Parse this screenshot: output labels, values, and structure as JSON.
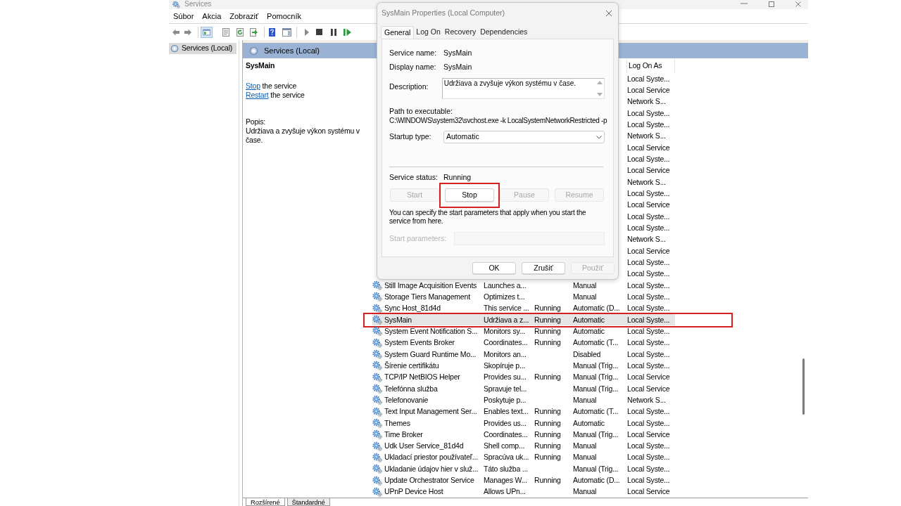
{
  "window": {
    "title": "Services"
  },
  "menu": [
    {
      "label": "Súbor"
    },
    {
      "label": "Akcia"
    },
    {
      "label": "Zobraziť"
    },
    {
      "label": "Pomocník"
    }
  ],
  "tree": {
    "items": [
      {
        "label": "Services (Local)",
        "selected": true
      }
    ]
  },
  "pane": {
    "title": "Services (Local)"
  },
  "details": {
    "title": "SysMain",
    "actions": [
      {
        "link": "Stop",
        "text": "the service"
      },
      {
        "link": "Restart",
        "text": "the service"
      }
    ],
    "description_label": "Popis:",
    "description": "Udržiava a zvyšuje výkon systému v čase."
  },
  "table": {
    "header": {
      "log_on_as": "Log On As"
    },
    "rows": [
      {
        "log_on_as": "Local Syste...",
        "selected": false,
        "annotated": false
      },
      {
        "log_on_as": "Local Service",
        "selected": false,
        "annotated": false
      },
      {
        "log_on_as": "Network S...",
        "selected": false,
        "annotated": false
      },
      {
        "log_on_as": "Local Syste...",
        "selected": false,
        "annotated": false
      },
      {
        "log_on_as": "Local Syste...",
        "selected": false,
        "annotated": false
      },
      {
        "log_on_as": "Network S...",
        "selected": false,
        "annotated": false
      },
      {
        "log_on_as": "Local Service",
        "selected": false,
        "annotated": false
      },
      {
        "log_on_as": "Local Syste...",
        "selected": false,
        "annotated": false
      },
      {
        "log_on_as": "Local Service",
        "selected": false,
        "annotated": false
      },
      {
        "log_on_as": "Network S...",
        "selected": false,
        "annotated": false
      },
      {
        "log_on_as": "Local Syste...",
        "selected": false,
        "annotated": false
      },
      {
        "log_on_as": "Local Service",
        "selected": false,
        "annotated": false
      },
      {
        "log_on_as": "Local Syste...",
        "selected": false,
        "annotated": false
      },
      {
        "log_on_as": "Local Syste...",
        "selected": false,
        "annotated": false
      },
      {
        "log_on_as": "Network S...",
        "selected": false,
        "annotated": false
      },
      {
        "log_on_as": "Local Service",
        "selected": false,
        "annotated": false
      },
      {
        "log_on_as": "Local Syste...",
        "selected": false,
        "annotated": false
      },
      {
        "log_on_as": "Local Syste...",
        "selected": false,
        "annotated": false
      },
      {
        "column_1": "Still Image Acquisition Events",
        "column_2": "Launches a...",
        "column_4": "Manual",
        "log_on_as": "Local Syste...",
        "selected": false,
        "annotated": false
      },
      {
        "column_1": "Storage Tiers Management",
        "column_2": "Optimizes t...",
        "column_4": "Manual",
        "log_on_as": "Local Syste...",
        "selected": false,
        "annotated": false
      },
      {
        "column_1": "Sync Host_81d4d",
        "column_2": "This service ...",
        "column_3": "Running",
        "column_4": "Automatic (D...",
        "log_on_as": "Local Syste...",
        "selected": false,
        "annotated": false
      },
      {
        "column_1": "SysMain",
        "column_2": "Udržiava a z...",
        "column_3": "Running",
        "column_4": "Automatic",
        "log_on_as": "Local Syste...",
        "selected": true,
        "annotated": true
      },
      {
        "column_1": "System Event Notification S...",
        "column_2": "Monitors sy...",
        "column_3": "Running",
        "column_4": "Automatic",
        "log_on_as": "Local Syste...",
        "selected": false,
        "annotated": false
      },
      {
        "column_1": "System Events Broker",
        "column_2": "Coordinates...",
        "column_3": "Running",
        "column_4": "Automatic (T...",
        "log_on_as": "Local Syste...",
        "selected": false,
        "annotated": false
      },
      {
        "column_1": "System Guard Runtime Mo...",
        "column_2": "Monitors an...",
        "column_4": "Disabled",
        "log_on_as": "Local Syste...",
        "selected": false,
        "annotated": false
      },
      {
        "column_1": "Šírenie certifikátu",
        "column_2": "Skopíruje p...",
        "column_4": "Manual (Trig...",
        "log_on_as": "Local Syste...",
        "selected": false,
        "annotated": false
      },
      {
        "column_1": "TCP/IP NetBIOS Helper",
        "column_2": "Provides su...",
        "column_3": "Running",
        "column_4": "Manual (Trig...",
        "log_on_as": "Local Service",
        "selected": false,
        "annotated": false
      },
      {
        "column_1": "Telefónna služba",
        "column_2": "Spravuje tel...",
        "column_4": "Manual (Trig...",
        "log_on_as": "Local Service",
        "selected": false,
        "annotated": false
      },
      {
        "column_1": "Telefonovanie",
        "column_2": "Poskytuje p...",
        "column_4": "Manual",
        "log_on_as": "Network S...",
        "selected": false,
        "annotated": false
      },
      {
        "column_1": "Text Input Management Ser...",
        "column_2": "Enables text...",
        "column_3": "Running",
        "column_4": "Automatic (T...",
        "log_on_as": "Local Syste...",
        "selected": false,
        "annotated": false
      },
      {
        "column_1": "Themes",
        "column_2": "Provides us...",
        "column_3": "Running",
        "column_4": "Automatic",
        "log_on_as": "Local Syste...",
        "selected": false,
        "annotated": false
      },
      {
        "column_1": "Time Broker",
        "column_2": "Coordinates...",
        "column_3": "Running",
        "column_4": "Manual (Trig...",
        "log_on_as": "Local Service",
        "selected": false,
        "annotated": false
      },
      {
        "column_1": "Udk User Service_81d4d",
        "column_2": "Shell comp...",
        "column_3": "Running",
        "column_4": "Manual",
        "log_on_as": "Local Syste...",
        "selected": false,
        "annotated": false
      },
      {
        "column_1": "Ukladací priestor používateľ...",
        "column_2": "Spracúva uk...",
        "column_3": "Running",
        "column_4": "Manual",
        "log_on_as": "Local Syste...",
        "selected": false,
        "annotated": false
      },
      {
        "column_1": "Ukladanie údajov hier v služ...",
        "column_2": "Táto služba ...",
        "column_4": "Manual (Trig...",
        "log_on_as": "Local Syste...",
        "selected": false,
        "annotated": false
      },
      {
        "column_1": "Update Orchestrator Service",
        "column_2": "Manages W...",
        "column_3": "Running",
        "column_4": "Automatic (D...",
        "log_on_as": "Local Syste...",
        "selected": false,
        "annotated": false
      },
      {
        "column_1": "UPnP Device Host",
        "column_2": "Allows UPn...",
        "column_4": "Manual",
        "log_on_as": "Local Service",
        "selected": false,
        "annotated": false
      }
    ]
  },
  "view_tabs": [
    {
      "label": "Rozšírené",
      "selected": true
    },
    {
      "label": "Štandardné",
      "selected": false
    }
  ],
  "dialog": {
    "title": "SysMain Properties (Local Computer)",
    "tabs": [
      {
        "label": "General",
        "selected": true
      },
      {
        "label": "Log On",
        "selected": false
      },
      {
        "label": "Recovery",
        "selected": false
      },
      {
        "label": "Dependencies",
        "selected": false
      }
    ],
    "fields": [
      {
        "label": "Service name:",
        "value": "SysMain"
      },
      {
        "label": "Display name:",
        "value": "SysMain"
      }
    ],
    "description": {
      "label": "Description:",
      "value": "Udržiava a zvyšuje výkon systému v čase."
    },
    "path": {
      "label": "Path to executable:",
      "value": "C:\\WINDOWS\\system32\\svchost.exe -k LocalSystemNetworkRestricted -p"
    },
    "startup_type": {
      "label": "Startup type:",
      "value": "Automatic"
    },
    "service_status": {
      "label": "Service status:",
      "value": "Running"
    },
    "control_buttons": [
      {
        "label": "Start",
        "disabled": true,
        "annotated": false
      },
      {
        "label": "Stop",
        "disabled": false,
        "annotated": true
      },
      {
        "label": "Pause",
        "disabled": true,
        "annotated": false
      },
      {
        "label": "Resume",
        "disabled": true,
        "annotated": false
      }
    ],
    "hint": "You can specify the start parameters that apply when you start the service from here.",
    "start_parameters": {
      "label": "Start parameters:",
      "disabled": true
    },
    "buttons": [
      {
        "label": "OK",
        "disabled": false
      },
      {
        "label": "Zrušiť",
        "disabled": false
      },
      {
        "label": "Použiť",
        "disabled": true
      }
    ]
  }
}
